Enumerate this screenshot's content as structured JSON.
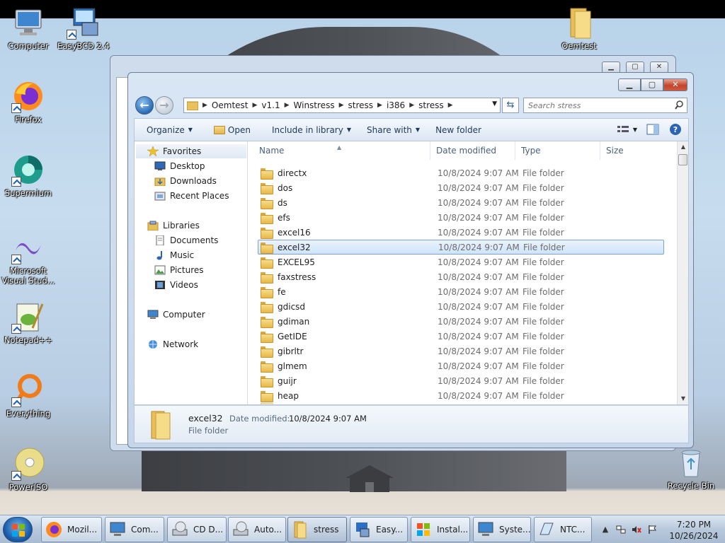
{
  "desktop": {
    "icons": [
      {
        "label": "Computer"
      },
      {
        "label": "EasyBCD 2.4"
      },
      {
        "label": "Oemtest"
      },
      {
        "label": "Firefox"
      },
      {
        "label": "Supermium"
      },
      {
        "label": "Microsoft Visual Stud..."
      },
      {
        "label": "Notepad++"
      },
      {
        "label": "Everything"
      },
      {
        "label": "PowerISO"
      },
      {
        "label": "Recycle Bin"
      }
    ]
  },
  "window": {
    "breadcrumbs": [
      "Oemtest",
      "v1.1",
      "Winstress",
      "stress",
      "i386",
      "stress"
    ],
    "search_placeholder": "Search stress",
    "toolbar": {
      "organize": "Organize",
      "open": "Open",
      "include_in_library": "Include in library",
      "share_with": "Share with",
      "new_folder": "New folder"
    },
    "nav_pane": {
      "favorites": "Favorites",
      "desktop": "Desktop",
      "downloads": "Downloads",
      "recent_places": "Recent Places",
      "libraries": "Libraries",
      "documents": "Documents",
      "music": "Music",
      "pictures": "Pictures",
      "videos": "Videos",
      "computer": "Computer",
      "network": "Network"
    },
    "columns": {
      "name": "Name",
      "date_modified": "Date modified",
      "type": "Type",
      "size": "Size"
    },
    "files": [
      {
        "name": "directx",
        "date": "10/8/2024 9:07 AM",
        "type": "File folder"
      },
      {
        "name": "dos",
        "date": "10/8/2024 9:07 AM",
        "type": "File folder"
      },
      {
        "name": "ds",
        "date": "10/8/2024 9:07 AM",
        "type": "File folder"
      },
      {
        "name": "efs",
        "date": "10/8/2024 9:07 AM",
        "type": "File folder"
      },
      {
        "name": "excel16",
        "date": "10/8/2024 9:07 AM",
        "type": "File folder"
      },
      {
        "name": "excel32",
        "date": "10/8/2024 9:07 AM",
        "type": "File folder",
        "selected": true
      },
      {
        "name": "EXCEL95",
        "date": "10/8/2024 9:07 AM",
        "type": "File folder"
      },
      {
        "name": "faxstress",
        "date": "10/8/2024 9:07 AM",
        "type": "File folder"
      },
      {
        "name": "fe",
        "date": "10/8/2024 9:07 AM",
        "type": "File folder"
      },
      {
        "name": "gdicsd",
        "date": "10/8/2024 9:07 AM",
        "type": "File folder"
      },
      {
        "name": "gdiman",
        "date": "10/8/2024 9:07 AM",
        "type": "File folder"
      },
      {
        "name": "GetIDE",
        "date": "10/8/2024 9:07 AM",
        "type": "File folder"
      },
      {
        "name": "gibrltr",
        "date": "10/8/2024 9:07 AM",
        "type": "File folder"
      },
      {
        "name": "glmem",
        "date": "10/8/2024 9:07 AM",
        "type": "File folder"
      },
      {
        "name": "guijr",
        "date": "10/8/2024 9:07 AM",
        "type": "File folder"
      },
      {
        "name": "heap",
        "date": "10/8/2024 9:07 AM",
        "type": "File folder"
      }
    ],
    "details": {
      "name": "excel32",
      "modified_label": "Date modified:",
      "modified_value": "10/8/2024 9:07 AM",
      "type": "File folder"
    }
  },
  "taskbar": {
    "buttons": [
      {
        "label": "Mozil..."
      },
      {
        "label": "Com..."
      },
      {
        "label": "CD D..."
      },
      {
        "label": "Auto..."
      },
      {
        "label": "stress"
      },
      {
        "label": "Easy..."
      },
      {
        "label": "Instal..."
      },
      {
        "label": "Syste..."
      },
      {
        "label": "NTC..."
      }
    ],
    "time": "7:20 PM",
    "date": "10/26/2024"
  },
  "colors": {
    "accent": "#2a6bb5",
    "selection": "#cfe4f9",
    "folder": "#e6b848",
    "close_button": "#c4452c"
  },
  "icons": [
    "folder-icon",
    "search-icon",
    "star-icon",
    "library-icon",
    "computer-icon",
    "network-icon",
    "windows-start-icon",
    "recycle-bin-icon"
  ]
}
